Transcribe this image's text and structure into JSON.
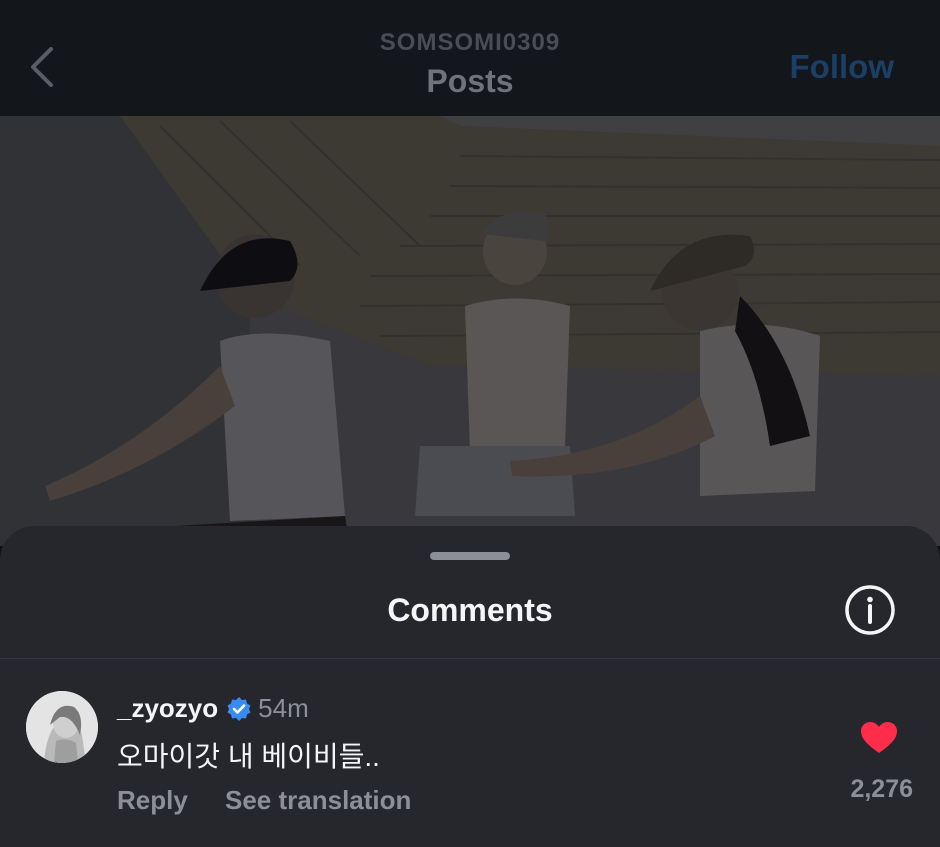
{
  "header": {
    "account": "SOMSOMI0309",
    "title": "Posts",
    "follow_label": "Follow",
    "follow_color": "#1c3f66"
  },
  "video": {
    "description_icon": "dance-video-frame"
  },
  "comments_sheet": {
    "title": "Comments",
    "info_icon": "info-icon",
    "comments": [
      {
        "username": "_zyozyo",
        "verified": true,
        "time": "54m",
        "text": "오마이갓 내 베이비들..",
        "reply_label": "Reply",
        "translate_label": "See translation",
        "liked": true,
        "like_count": "2,276",
        "like_color": "#ff2d4a"
      }
    ]
  }
}
